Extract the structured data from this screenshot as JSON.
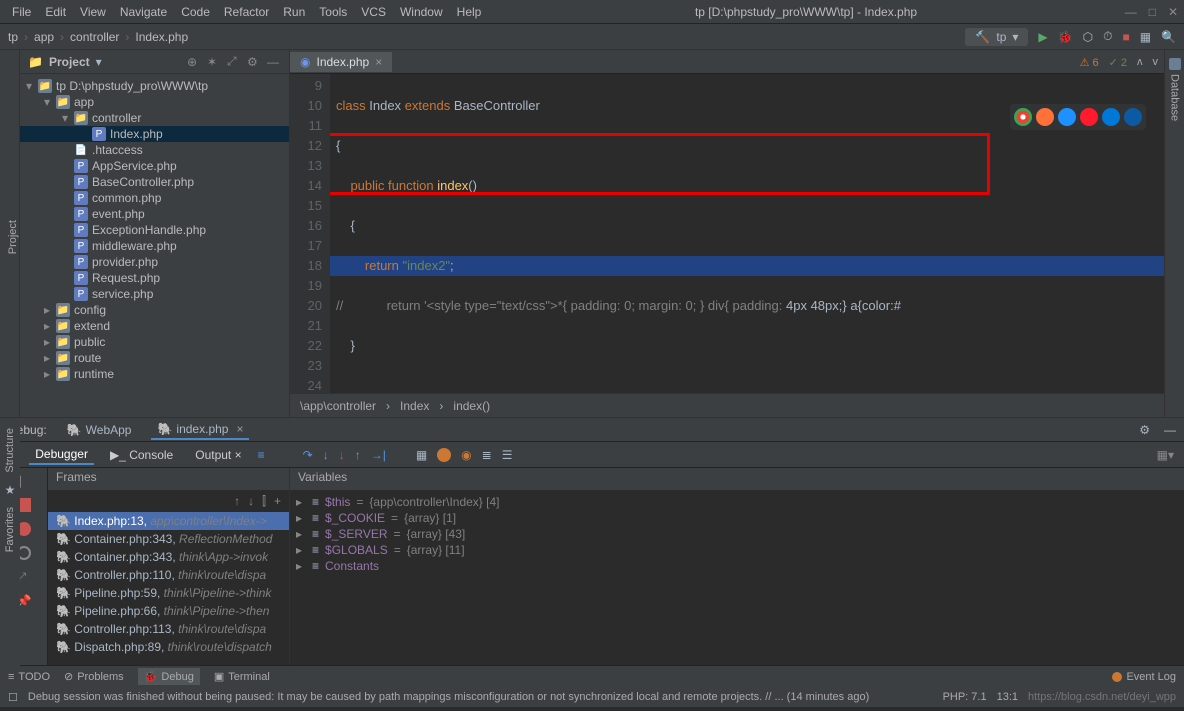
{
  "menus": [
    "File",
    "Edit",
    "View",
    "Navigate",
    "Code",
    "Refactor",
    "Run",
    "Tools",
    "VCS",
    "Window",
    "Help"
  ],
  "windowTitle": "tp [D:\\phpstudy_pro\\WWW\\tp] - Index.php",
  "breadcrumb": [
    "tp",
    "app",
    "controller",
    "Index.php"
  ],
  "runConfig": "tp",
  "project": {
    "title": "Project",
    "tree": [
      {
        "d": 0,
        "icon": "fold",
        "arr": "▾",
        "label": "tp",
        "suffix": " D:\\phpstudy_pro\\WWW\\tp"
      },
      {
        "d": 1,
        "icon": "fold",
        "arr": "▾",
        "label": "app"
      },
      {
        "d": 2,
        "icon": "fold",
        "arr": "▾",
        "label": "controller"
      },
      {
        "d": 3,
        "icon": "php",
        "arr": "",
        "label": "Index.php",
        "sel": true
      },
      {
        "d": 2,
        "icon": "txt",
        "arr": "",
        "label": ".htaccess"
      },
      {
        "d": 2,
        "icon": "php",
        "arr": "",
        "label": "AppService.php"
      },
      {
        "d": 2,
        "icon": "php",
        "arr": "",
        "label": "BaseController.php"
      },
      {
        "d": 2,
        "icon": "php",
        "arr": "",
        "label": "common.php"
      },
      {
        "d": 2,
        "icon": "php",
        "arr": "",
        "label": "event.php"
      },
      {
        "d": 2,
        "icon": "php",
        "arr": "",
        "label": "ExceptionHandle.php"
      },
      {
        "d": 2,
        "icon": "php",
        "arr": "",
        "label": "middleware.php"
      },
      {
        "d": 2,
        "icon": "php",
        "arr": "",
        "label": "provider.php"
      },
      {
        "d": 2,
        "icon": "php",
        "arr": "",
        "label": "Request.php"
      },
      {
        "d": 2,
        "icon": "php",
        "arr": "",
        "label": "service.php"
      },
      {
        "d": 1,
        "icon": "fold",
        "arr": "▸",
        "label": "config"
      },
      {
        "d": 1,
        "icon": "fold",
        "arr": "▸",
        "label": "extend"
      },
      {
        "d": 1,
        "icon": "fold",
        "arr": "▸",
        "label": "public"
      },
      {
        "d": 1,
        "icon": "fold",
        "arr": "▸",
        "label": "route"
      },
      {
        "d": 1,
        "icon": "fold",
        "arr": "▸",
        "label": "runtime"
      }
    ]
  },
  "editor": {
    "tab": "Index.php",
    "warn": "⚠ 6",
    "ok": "✓ 2",
    "lines": [
      9,
      10,
      11,
      12,
      13,
      14,
      15,
      16,
      17,
      18,
      19,
      20,
      21,
      22,
      23,
      24
    ],
    "crumb": [
      "\\app\\controller",
      "Index",
      "index()"
    ]
  },
  "debug": {
    "label": "Debug:",
    "tabs": [
      "WebApp",
      "index.php"
    ],
    "sub": [
      "Debugger",
      "Console",
      "Output"
    ],
    "framesTitle": "Frames",
    "varsTitle": "Variables",
    "frames": [
      {
        "loc": "Index.php:13,",
        "path": " app\\controller\\Index->",
        "sel": true
      },
      {
        "loc": "Container.php:343,",
        "path": " ReflectionMethod"
      },
      {
        "loc": "Container.php:343,",
        "path": " think\\App->invok"
      },
      {
        "loc": "Controller.php:110,",
        "path": " think\\route\\dispa"
      },
      {
        "loc": "Pipeline.php:59,",
        "path": " think\\Pipeline->think"
      },
      {
        "loc": "Pipeline.php:66,",
        "path": " think\\Pipeline->then"
      },
      {
        "loc": "Controller.php:113,",
        "path": " think\\route\\dispa"
      },
      {
        "loc": "Dispatch.php:89,",
        "path": " think\\route\\dispatch"
      }
    ],
    "vars": [
      {
        "name": "$this",
        "eq": "=",
        "val": "{app\\controller\\Index} [4]"
      },
      {
        "name": "$_COOKIE",
        "eq": "=",
        "val": "{array} [1]"
      },
      {
        "name": "$_SERVER",
        "eq": "=",
        "val": "{array} [43]"
      },
      {
        "name": "$GLOBALS",
        "eq": "=",
        "val": "{array} [11]"
      },
      {
        "name": "Constants",
        "eq": "",
        "val": ""
      }
    ]
  },
  "bottomTabs": [
    "TODO",
    "Problems",
    "Debug",
    "Terminal"
  ],
  "eventLog": "Event Log",
  "statusMsg": "Debug session was finished without being paused: It may be caused by path mappings misconfiguration or not synchronized local and remote projects. // ... (14 minutes ago)",
  "statusRight": [
    "PHP: 7.1",
    "13:1",
    "https://blog.csdn.net/deyi_wpp"
  ],
  "leftSide": [
    "Project"
  ],
  "leftSide2": [
    "Structure",
    "Favorites"
  ],
  "rightSide": "Database"
}
